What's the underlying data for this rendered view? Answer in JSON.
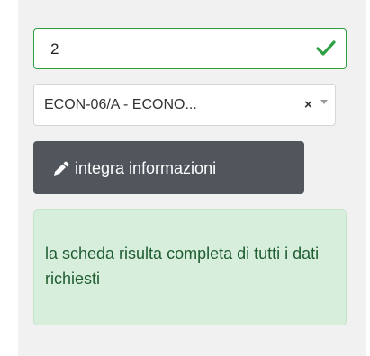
{
  "form": {
    "number_value": "2",
    "select_value": "ECON-06/A - ECONO...",
    "clear_symbol": "×",
    "button_label": "integra informazioni",
    "status_message": "la scheda risulta completa di tutti i dati richiesti"
  },
  "icons": {
    "valid": "check-icon",
    "clear": "close-icon",
    "dropdown": "caret-down-icon",
    "edit": "pencil-icon"
  },
  "colors": {
    "valid_border": "#2ea044",
    "button_bg": "#50565c",
    "alert_bg": "#d7eedc",
    "alert_text": "#1f5d31"
  }
}
